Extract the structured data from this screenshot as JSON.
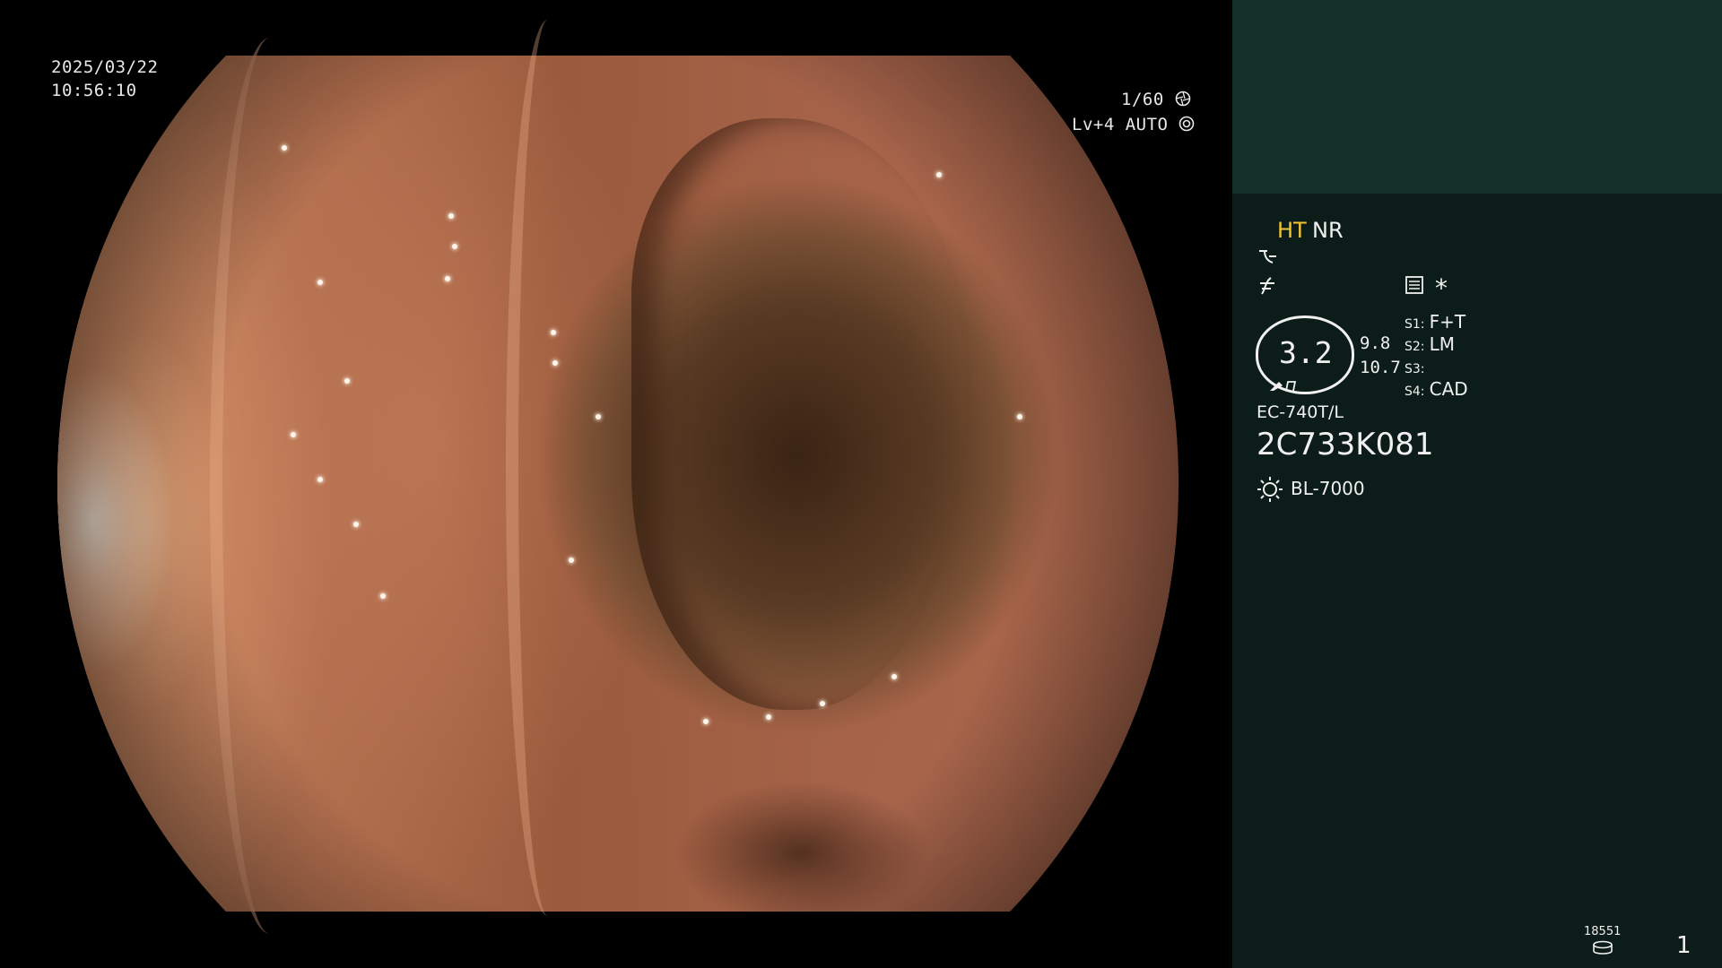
{
  "overlay": {
    "date": "2025/03/22",
    "time": "10:56:10",
    "shutter": "1/60",
    "shutter_icon": "aperture-icon",
    "light_level": "Lv+4 AUTO",
    "light_icon": "iris-icon"
  },
  "panel": {
    "mode_ht": "HT",
    "mode_nr": "NR",
    "mode_ht_color": "#f5c531",
    "curve_icon_1": "tone-curve-icon",
    "curve_icon_2": "edge-enhance-icon",
    "settings_icon": "menu-settings-icon",
    "asterisk": "*",
    "zoom_value": "3.2",
    "readout_top": "9.8",
    "readout_bottom": "10.7",
    "switches": [
      {
        "key": "S1:",
        "value": "F+T"
      },
      {
        "key": "S2:",
        "value": "LM"
      },
      {
        "key": "S3:",
        "value": ""
      },
      {
        "key": "S4:",
        "value": "CAD"
      }
    ],
    "scope_model": "EC-740T/L",
    "serial_number": "2C733K081",
    "light_source": "BL-7000",
    "light_source_icon": "light-source-icon",
    "record_count": "18551",
    "record_icon": "disk-icon",
    "page_number": "1"
  }
}
